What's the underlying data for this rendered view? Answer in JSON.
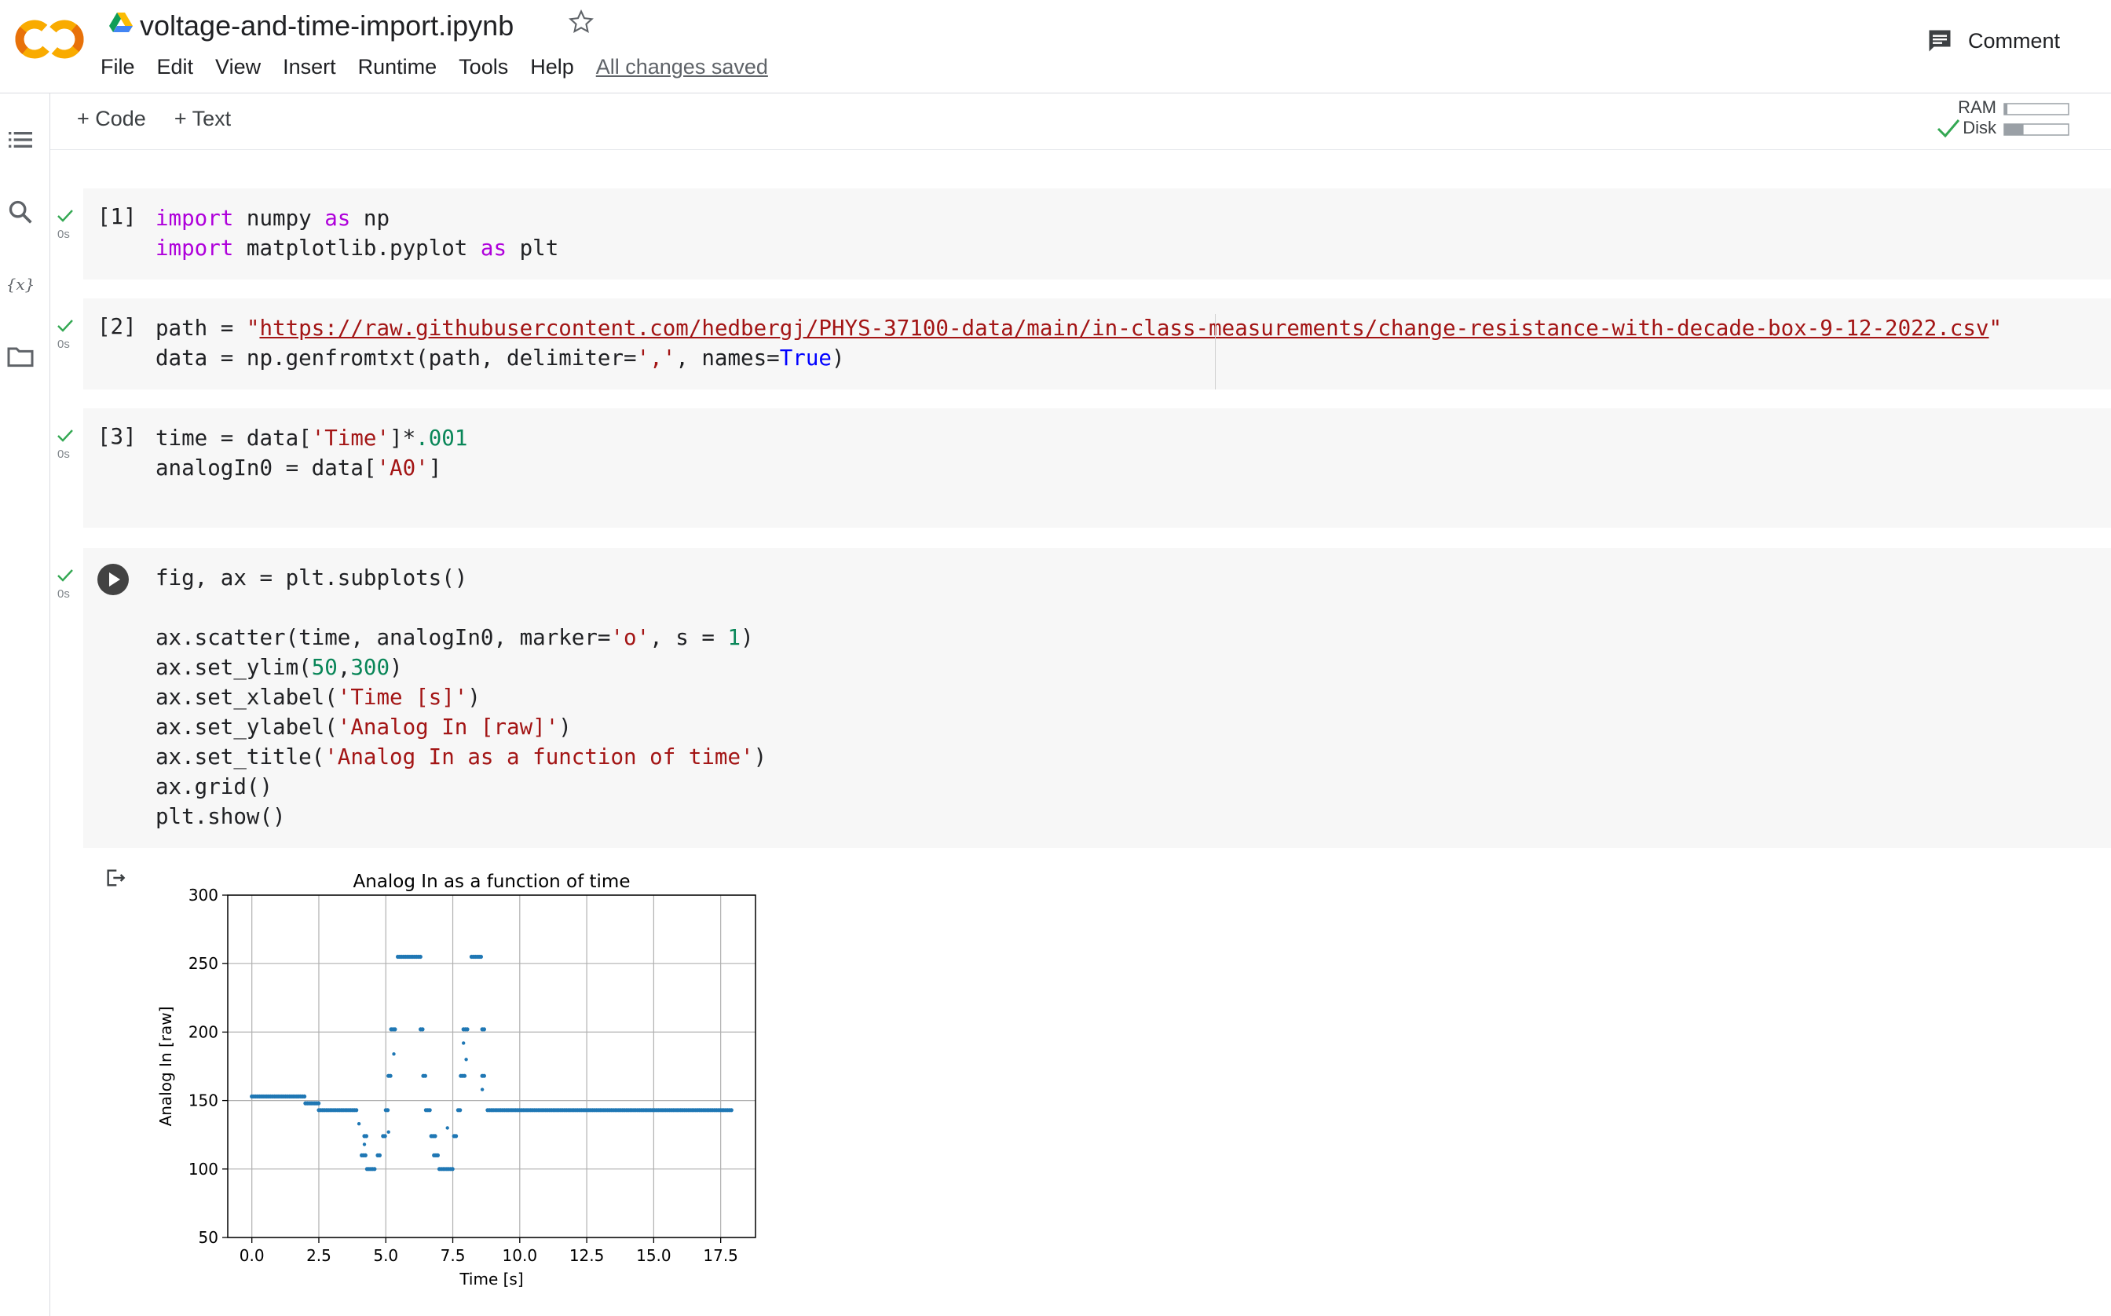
{
  "header": {
    "title": "voltage-and-time-import.ipynb",
    "menu": [
      "File",
      "Edit",
      "View",
      "Insert",
      "Runtime",
      "Tools",
      "Help"
    ],
    "save_status": "All changes saved",
    "comment_label": "Comment"
  },
  "toolbar": {
    "add_code": "+ Code",
    "add_text": "+ Text",
    "ram_label": "RAM",
    "disk_label": "Disk",
    "ram_usage": 0.05,
    "disk_usage": 0.3
  },
  "colors": {
    "accent_orange": "#f9ab00",
    "check_green": "#34a853",
    "point_blue": "#1f77b4"
  },
  "icons": [
    "colab-logo",
    "drive-icon",
    "star-icon",
    "comment-icon",
    "toc-icon",
    "search-icon",
    "variables-icon",
    "folder-icon",
    "run-icon",
    "output-icon",
    "check-icon"
  ],
  "cells": [
    {
      "prompt": "[1]",
      "duration": "0s",
      "lines": [
        "import numpy as np",
        "import matplotlib.pyplot as plt"
      ]
    },
    {
      "prompt": "[2]",
      "duration": "0s",
      "lines": [
        "path = \"https://raw.githubusercontent.com/hedbergj/PHYS-37100-data/main/in-class-measurements/change-resistance-with-decade-box-9-12-2022.csv\"",
        "data = np.genfromtxt(path, delimiter=',', names=True)"
      ]
    },
    {
      "prompt": "[3]",
      "duration": "0s",
      "lines": [
        "time = data['Time']*.001",
        "analogIn0 = data['A0']"
      ]
    },
    {
      "prompt": "",
      "duration": "0s",
      "lines": [
        "fig, ax = plt.subplots()",
        "",
        "ax.scatter(time, analogIn0, marker='o', s = 1)",
        "ax.set_ylim(50,300)",
        "ax.set_xlabel('Time [s]')",
        "ax.set_ylabel('Analog In [raw]')",
        "ax.set_title('Analog In as a function of time')",
        "ax.grid()",
        "plt.show()"
      ]
    }
  ],
  "chart_data": {
    "type": "scatter",
    "title": "Analog In as a function of time",
    "xlabel": "Time [s]",
    "ylabel": "Analog In [raw]",
    "xlim": [
      -0.9,
      18.8
    ],
    "ylim": [
      50,
      300
    ],
    "xticks": [
      "0.0",
      "2.5",
      "5.0",
      "7.5",
      "10.0",
      "12.5",
      "15.0",
      "17.5"
    ],
    "yticks": [
      "50",
      "100",
      "150",
      "200",
      "250",
      "300"
    ],
    "grid": true,
    "segments": [
      {
        "x0": 0.0,
        "x1": 2.0,
        "y": 153
      },
      {
        "x0": 2.0,
        "x1": 2.5,
        "y": 148
      },
      {
        "x0": 2.5,
        "x1": 3.9,
        "y": 143
      },
      {
        "x0": 4.2,
        "x1": 4.3,
        "y": 124
      },
      {
        "x0": 4.1,
        "x1": 4.3,
        "y": 110
      },
      {
        "x0": 4.3,
        "x1": 4.6,
        "y": 100
      },
      {
        "x0": 4.7,
        "x1": 4.8,
        "y": 110
      },
      {
        "x0": 4.9,
        "x1": 5.0,
        "y": 124
      },
      {
        "x0": 5.0,
        "x1": 5.1,
        "y": 143
      },
      {
        "x0": 5.1,
        "x1": 5.2,
        "y": 168
      },
      {
        "x0": 5.2,
        "x1": 5.4,
        "y": 202
      },
      {
        "x0": 5.45,
        "x1": 6.3,
        "y": 255
      },
      {
        "x0": 6.3,
        "x1": 6.4,
        "y": 202
      },
      {
        "x0": 6.4,
        "x1": 6.5,
        "y": 168
      },
      {
        "x0": 6.5,
        "x1": 6.7,
        "y": 143
      },
      {
        "x0": 6.7,
        "x1": 6.9,
        "y": 124
      },
      {
        "x0": 6.8,
        "x1": 7.0,
        "y": 110
      },
      {
        "x0": 7.0,
        "x1": 7.5,
        "y": 100
      },
      {
        "x0": 7.55,
        "x1": 7.65,
        "y": 124
      },
      {
        "x0": 7.7,
        "x1": 7.8,
        "y": 143
      },
      {
        "x0": 7.8,
        "x1": 8.0,
        "y": 168
      },
      {
        "x0": 7.9,
        "x1": 8.1,
        "y": 202
      },
      {
        "x0": 8.2,
        "x1": 8.6,
        "y": 255
      },
      {
        "x0": 8.6,
        "x1": 8.7,
        "y": 202
      },
      {
        "x0": 8.6,
        "x1": 8.7,
        "y": 168
      },
      {
        "x0": 8.8,
        "x1": 17.9,
        "y": 143
      }
    ],
    "points": [
      {
        "x": 4.0,
        "y": 133
      },
      {
        "x": 4.2,
        "y": 118
      },
      {
        "x": 5.1,
        "y": 127
      },
      {
        "x": 5.3,
        "y": 184
      },
      {
        "x": 7.9,
        "y": 192
      },
      {
        "x": 8.0,
        "y": 180
      },
      {
        "x": 8.6,
        "y": 158
      },
      {
        "x": 7.3,
        "y": 130
      }
    ]
  }
}
